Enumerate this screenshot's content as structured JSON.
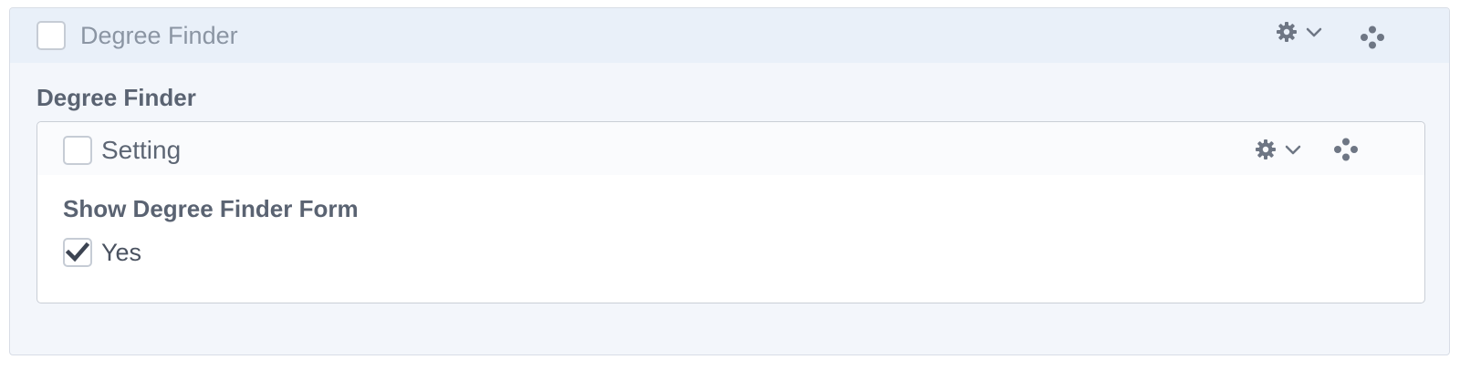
{
  "block": {
    "title": "Degree Finder",
    "section_title": "Degree Finder",
    "header_icons": [
      "gear-icon",
      "chevron-down-icon",
      "drag-handle-icon"
    ]
  },
  "setting": {
    "title": "Setting",
    "field_label": "Show Degree Finder Form",
    "option_label": "Yes",
    "option_checked": true,
    "header_icons": [
      "gear-icon",
      "chevron-down-icon",
      "drag-handle-icon"
    ]
  },
  "colors": {
    "icon": "#6e7684",
    "header_bg": "#e9f0f9",
    "panel_bg": "#f3f6fb",
    "checkmark": "#3c4452"
  }
}
